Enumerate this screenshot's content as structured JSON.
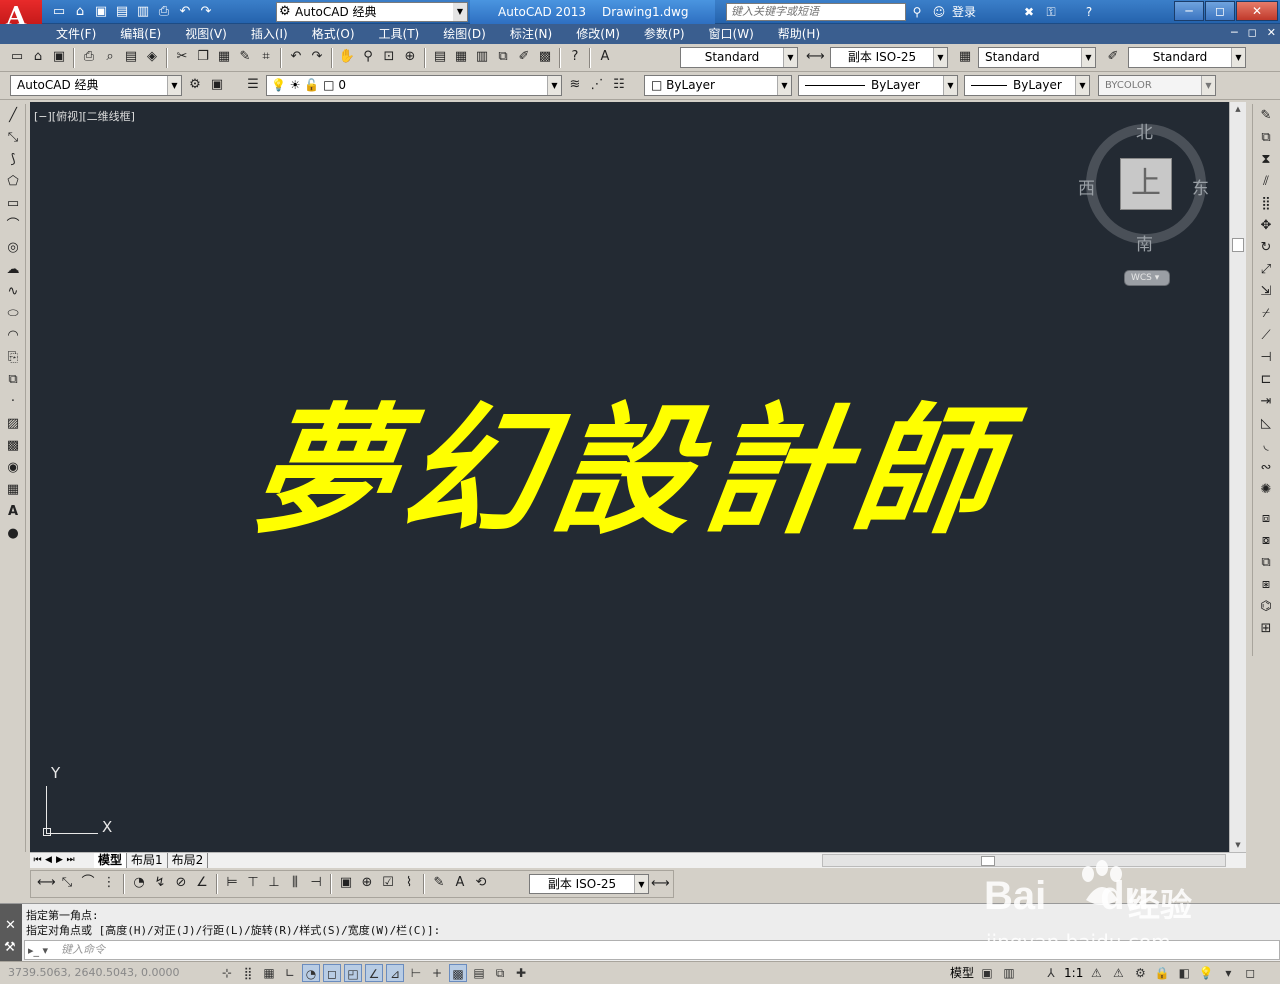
{
  "titlebar": {
    "logo": "A",
    "qat_icons": [
      "new-icon",
      "open-icon",
      "save-icon",
      "saveas-icon",
      "plot-icon",
      "print-icon",
      "undo-icon",
      "redo-icon"
    ],
    "workspace": "AutoCAD 经典",
    "app_name": "AutoCAD 2013",
    "document": "Drawing1.dwg",
    "search_placeholder": "键入关键字或短语",
    "login": "登录",
    "window_buttons": [
      "─",
      "◻",
      "✕"
    ]
  },
  "menubar": {
    "items": [
      "文件(F)",
      "编辑(E)",
      "视图(V)",
      "插入(I)",
      "格式(O)",
      "工具(T)",
      "绘图(D)",
      "标注(N)",
      "修改(M)",
      "参数(P)",
      "窗口(W)",
      "帮助(H)"
    ],
    "mdi_buttons": [
      "─",
      "◻",
      "✕"
    ]
  },
  "toolbar1": {
    "text_style": "Standard",
    "dim_style": "副本 ISO-25",
    "table_style": "Standard",
    "mleader_style": "Standard"
  },
  "toolbar2": {
    "workspace": "AutoCAD 经典",
    "layer": "0",
    "color": "ByLayer",
    "linetype": "ByLayer",
    "lineweight": "ByLayer",
    "plotstyle": "BYCOLOR"
  },
  "viewport": {
    "label": "[−][俯视][二维线框]",
    "main_text": "夢幻設計師",
    "viewcube": {
      "face": "上",
      "north": "北",
      "south": "南",
      "east": "东",
      "west": "西"
    },
    "wcs": "WCS ▾",
    "ucs": {
      "x": "X",
      "y": "Y"
    },
    "colors": {
      "background": "#232a33",
      "text": "#ffff00"
    }
  },
  "tabs": {
    "items": [
      "模型",
      "布局1",
      "布局2"
    ],
    "active": "模型"
  },
  "dimbar": {
    "dim_style": "副本 ISO-25"
  },
  "command": {
    "line1": "指定第一角点:",
    "line2": "指定对角点或 [高度(H)/对正(J)/行距(L)/旋转(R)/样式(S)/宽度(W)/栏(C)]:",
    "placeholder": "键入命令"
  },
  "statusbar": {
    "coords": "3739.5063,  2640.5043,  0.0000",
    "model": "模型",
    "scale": "1:1"
  },
  "watermark": {
    "brand": "Bai",
    "brand2": "du",
    "jingyan": "经验",
    "url": "jingyan.baidu.com"
  }
}
